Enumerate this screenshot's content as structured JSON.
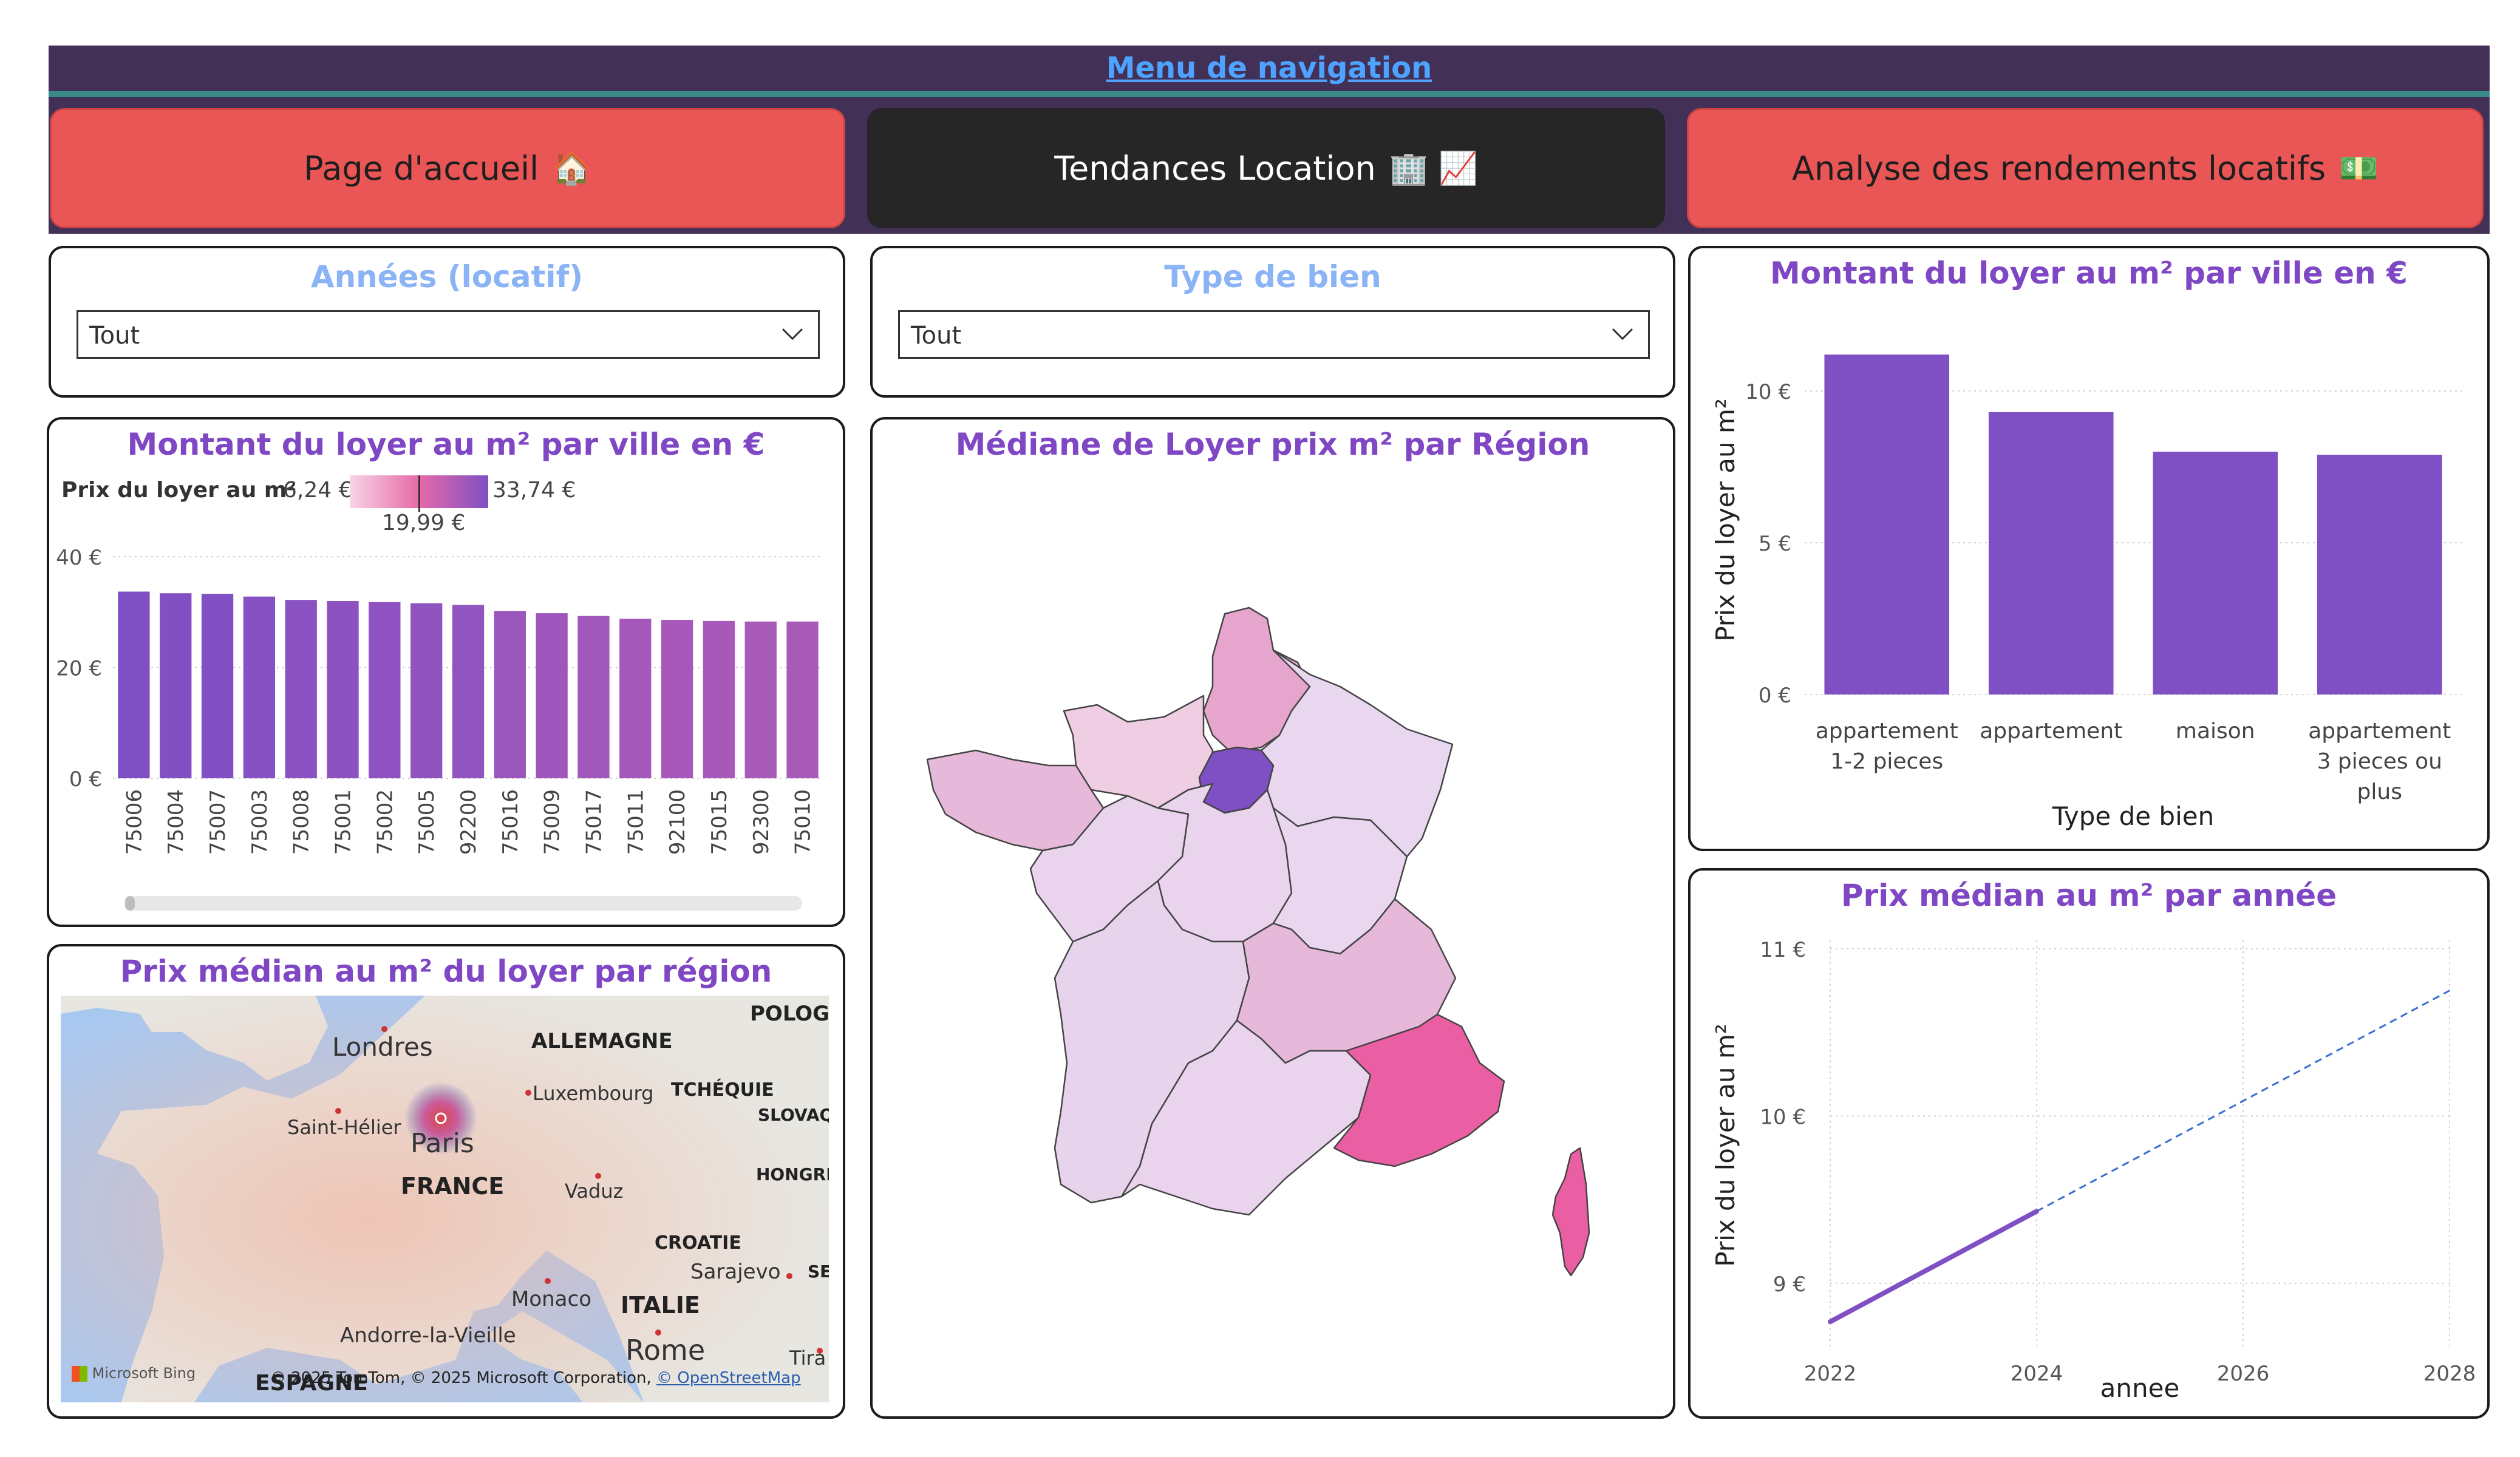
{
  "nav": {
    "title": "Menu de navigation",
    "buttons": [
      {
        "label": "Page d'accueil",
        "icon": "🏠"
      },
      {
        "label": "Tendances Location",
        "icon": "🏢 📈"
      },
      {
        "label": "Analyse des rendements locatifs",
        "icon": "💵"
      }
    ]
  },
  "filters": {
    "years": {
      "title": "Années (locatif)",
      "value": "Tout"
    },
    "type": {
      "title": "Type de bien",
      "value": "Tout"
    }
  },
  "city_chart": {
    "title": "Montant du loyer au m² par ville en €",
    "legend": {
      "label": "Prix du loyer au m²",
      "min": "6,24 €",
      "max": "33,74 €",
      "mid": "19,99 €"
    },
    "y_ticks": [
      "40 €",
      "20 €",
      "0 €"
    ]
  },
  "region_map": {
    "title": "Médiane de Loyer prix m² par Région"
  },
  "bing_map": {
    "title": "Prix médian au m² du loyer par région",
    "labels": [
      "Londres",
      "ALLEMAGNE",
      "POLOGI",
      "Luxembourg",
      "TCHÉQUIE",
      "SLOVAQ",
      "Saint-Hélier",
      "Paris",
      "FRANCE",
      "HONGRI",
      "Vaduz",
      "CROATIE",
      "Sarajevo",
      "SE",
      "Monaco",
      "ITALIE",
      "Andorre-la-Vieille",
      "Rome",
      "Tira",
      "ESPAGNE"
    ],
    "attribution": "© 2025 TomTom, © 2025 Microsoft Corporation,",
    "osm": "© OpenStreetMap",
    "logo": "Microsoft Bing"
  },
  "type_chart": {
    "title": "Montant du loyer au m² par ville en €",
    "xlabel": "Type de bien",
    "ylabel": "Prix du loyer au m²",
    "y_ticks": [
      "10 €",
      "5 €",
      "0 €"
    ],
    "category_lines": [
      [
        "appartement",
        "1-2 pieces"
      ],
      [
        "appartement"
      ],
      [
        "maison"
      ],
      [
        "appartement",
        "3 pieces ou",
        "plus"
      ]
    ]
  },
  "year_chart": {
    "title": "Prix médian au m² par année",
    "xlabel": "annee",
    "ylabel": "Prix du loyer au m²",
    "y_ticks": [
      "11 €",
      "10 €",
      "9 €"
    ],
    "x_ticks": [
      "2022",
      "2024",
      "2026",
      "2028"
    ]
  },
  "chart_data": [
    {
      "type": "bar",
      "title": "Montant du loyer au m² par ville en €",
      "categories": [
        "75006",
        "75004",
        "75007",
        "75003",
        "75008",
        "75001",
        "75002",
        "75005",
        "92200",
        "75016",
        "75009",
        "75017",
        "75011",
        "92100",
        "75015",
        "92300",
        "75010"
      ],
      "values": [
        33.7,
        33.4,
        33.3,
        32.8,
        32.2,
        32.0,
        31.8,
        31.6,
        31.3,
        30.2,
        29.8,
        29.3,
        28.8,
        28.6,
        28.4,
        28.3,
        28.3
      ],
      "ylim": [
        0,
        40
      ],
      "grid": true,
      "legend": "top-left"
    },
    {
      "type": "bar",
      "title": "Montant du loyer au m² par ville en €",
      "categories": [
        "appartement 1-2 pieces",
        "appartement",
        "maison",
        "appartement 3 pieces ou plus"
      ],
      "values": [
        11.2,
        9.3,
        8.0,
        7.9
      ],
      "xlabel": "Type de bien",
      "ylabel": "Prix du loyer au m²",
      "ylim": [
        0,
        11.5
      ],
      "grid": true,
      "color": "#7f4fc4"
    },
    {
      "type": "line",
      "title": "Prix médian au m² par année",
      "x": [
        2022,
        2024
      ],
      "y": [
        8.77,
        9.43
      ],
      "trend": {
        "x": [
          2024,
          2028
        ],
        "y": [
          9.43,
          10.75
        ]
      },
      "xlabel": "annee",
      "ylabel": "Prix du loyer au m²",
      "xlim": [
        2022,
        2028
      ],
      "ylim": [
        8.6,
        11.05
      ],
      "grid": true,
      "color": "#7f4fc4",
      "trend_color": "#3a6fd1"
    }
  ]
}
